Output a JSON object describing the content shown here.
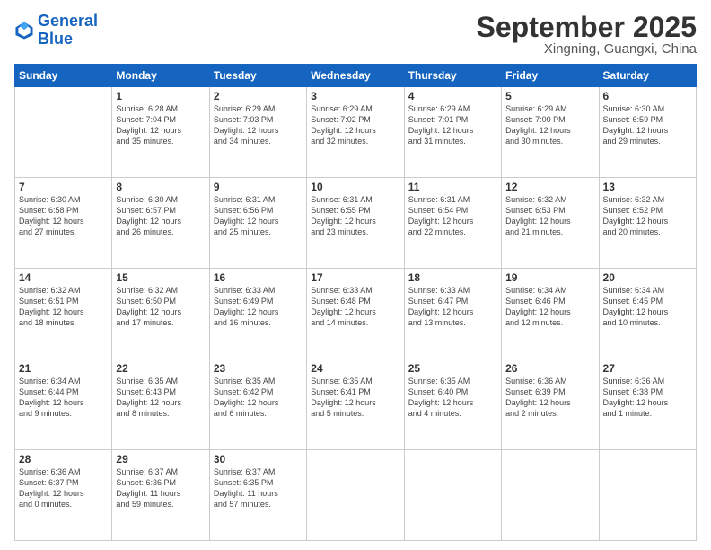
{
  "logo": {
    "line1": "General",
    "line2": "Blue"
  },
  "header": {
    "month": "September 2025",
    "location": "Xingning, Guangxi, China"
  },
  "weekdays": [
    "Sunday",
    "Monday",
    "Tuesday",
    "Wednesday",
    "Thursday",
    "Friday",
    "Saturday"
  ],
  "weeks": [
    [
      {
        "day": "",
        "info": ""
      },
      {
        "day": "1",
        "info": "Sunrise: 6:28 AM\nSunset: 7:04 PM\nDaylight: 12 hours\nand 35 minutes."
      },
      {
        "day": "2",
        "info": "Sunrise: 6:29 AM\nSunset: 7:03 PM\nDaylight: 12 hours\nand 34 minutes."
      },
      {
        "day": "3",
        "info": "Sunrise: 6:29 AM\nSunset: 7:02 PM\nDaylight: 12 hours\nand 32 minutes."
      },
      {
        "day": "4",
        "info": "Sunrise: 6:29 AM\nSunset: 7:01 PM\nDaylight: 12 hours\nand 31 minutes."
      },
      {
        "day": "5",
        "info": "Sunrise: 6:29 AM\nSunset: 7:00 PM\nDaylight: 12 hours\nand 30 minutes."
      },
      {
        "day": "6",
        "info": "Sunrise: 6:30 AM\nSunset: 6:59 PM\nDaylight: 12 hours\nand 29 minutes."
      }
    ],
    [
      {
        "day": "7",
        "info": "Sunrise: 6:30 AM\nSunset: 6:58 PM\nDaylight: 12 hours\nand 27 minutes."
      },
      {
        "day": "8",
        "info": "Sunrise: 6:30 AM\nSunset: 6:57 PM\nDaylight: 12 hours\nand 26 minutes."
      },
      {
        "day": "9",
        "info": "Sunrise: 6:31 AM\nSunset: 6:56 PM\nDaylight: 12 hours\nand 25 minutes."
      },
      {
        "day": "10",
        "info": "Sunrise: 6:31 AM\nSunset: 6:55 PM\nDaylight: 12 hours\nand 23 minutes."
      },
      {
        "day": "11",
        "info": "Sunrise: 6:31 AM\nSunset: 6:54 PM\nDaylight: 12 hours\nand 22 minutes."
      },
      {
        "day": "12",
        "info": "Sunrise: 6:32 AM\nSunset: 6:53 PM\nDaylight: 12 hours\nand 21 minutes."
      },
      {
        "day": "13",
        "info": "Sunrise: 6:32 AM\nSunset: 6:52 PM\nDaylight: 12 hours\nand 20 minutes."
      }
    ],
    [
      {
        "day": "14",
        "info": "Sunrise: 6:32 AM\nSunset: 6:51 PM\nDaylight: 12 hours\nand 18 minutes."
      },
      {
        "day": "15",
        "info": "Sunrise: 6:32 AM\nSunset: 6:50 PM\nDaylight: 12 hours\nand 17 minutes."
      },
      {
        "day": "16",
        "info": "Sunrise: 6:33 AM\nSunset: 6:49 PM\nDaylight: 12 hours\nand 16 minutes."
      },
      {
        "day": "17",
        "info": "Sunrise: 6:33 AM\nSunset: 6:48 PM\nDaylight: 12 hours\nand 14 minutes."
      },
      {
        "day": "18",
        "info": "Sunrise: 6:33 AM\nSunset: 6:47 PM\nDaylight: 12 hours\nand 13 minutes."
      },
      {
        "day": "19",
        "info": "Sunrise: 6:34 AM\nSunset: 6:46 PM\nDaylight: 12 hours\nand 12 minutes."
      },
      {
        "day": "20",
        "info": "Sunrise: 6:34 AM\nSunset: 6:45 PM\nDaylight: 12 hours\nand 10 minutes."
      }
    ],
    [
      {
        "day": "21",
        "info": "Sunrise: 6:34 AM\nSunset: 6:44 PM\nDaylight: 12 hours\nand 9 minutes."
      },
      {
        "day": "22",
        "info": "Sunrise: 6:35 AM\nSunset: 6:43 PM\nDaylight: 12 hours\nand 8 minutes."
      },
      {
        "day": "23",
        "info": "Sunrise: 6:35 AM\nSunset: 6:42 PM\nDaylight: 12 hours\nand 6 minutes."
      },
      {
        "day": "24",
        "info": "Sunrise: 6:35 AM\nSunset: 6:41 PM\nDaylight: 12 hours\nand 5 minutes."
      },
      {
        "day": "25",
        "info": "Sunrise: 6:35 AM\nSunset: 6:40 PM\nDaylight: 12 hours\nand 4 minutes."
      },
      {
        "day": "26",
        "info": "Sunrise: 6:36 AM\nSunset: 6:39 PM\nDaylight: 12 hours\nand 2 minutes."
      },
      {
        "day": "27",
        "info": "Sunrise: 6:36 AM\nSunset: 6:38 PM\nDaylight: 12 hours\nand 1 minute."
      }
    ],
    [
      {
        "day": "28",
        "info": "Sunrise: 6:36 AM\nSunset: 6:37 PM\nDaylight: 12 hours\nand 0 minutes."
      },
      {
        "day": "29",
        "info": "Sunrise: 6:37 AM\nSunset: 6:36 PM\nDaylight: 11 hours\nand 59 minutes."
      },
      {
        "day": "30",
        "info": "Sunrise: 6:37 AM\nSunset: 6:35 PM\nDaylight: 11 hours\nand 57 minutes."
      },
      {
        "day": "",
        "info": ""
      },
      {
        "day": "",
        "info": ""
      },
      {
        "day": "",
        "info": ""
      },
      {
        "day": "",
        "info": ""
      }
    ]
  ]
}
